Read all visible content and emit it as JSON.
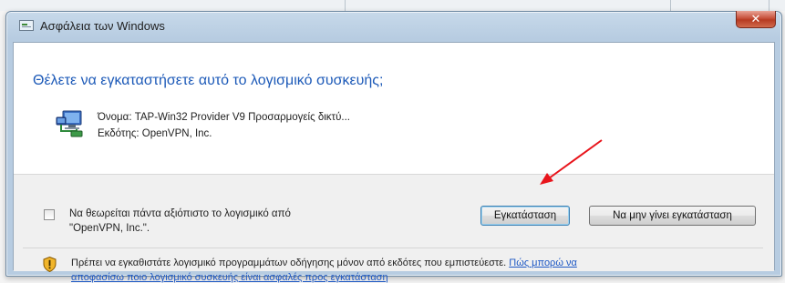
{
  "window": {
    "title": "Ασφάλεια των Windows",
    "close_glyph": "✕"
  },
  "dialog": {
    "heading": "Θέλετε να εγκαταστήσετε αυτό το λογισμικό συσκευής;",
    "device_name": "Όνομα: TAP-Win32 Provider V9 Προσαρμογείς δικτύ...",
    "publisher": "Εκδότης: OpenVPN, Inc.",
    "device_icon": "network-adapter-icon",
    "trust_checkbox": {
      "label_line1": "Να θεωρείται πάντα αξιόπιστο το λογισμικό από",
      "label_line2": "\"OpenVPN, Inc.\".",
      "checked": false
    },
    "install_button": "Εγκατάσταση",
    "dont_install_button": "Να μην γίνει εγκατάσταση",
    "warning_icon": "shield-warning-icon",
    "warning_text": "Πρέπει να εγκαθιστάτε λογισμικό προγραμμάτων οδήγησης μόνον από εκδότες που εμπιστεύεστε.",
    "help_link_line1": "Πώς μπορώ να",
    "help_link_line2": "αποφασίσω ποιο λογισμικό συσκευής είναι ασφαλές προς εγκατάσταση"
  },
  "colors": {
    "heading": "#1d5ab8",
    "link": "#1c57c4",
    "arrow": "#e8141b",
    "close_button": "#c7503a"
  }
}
